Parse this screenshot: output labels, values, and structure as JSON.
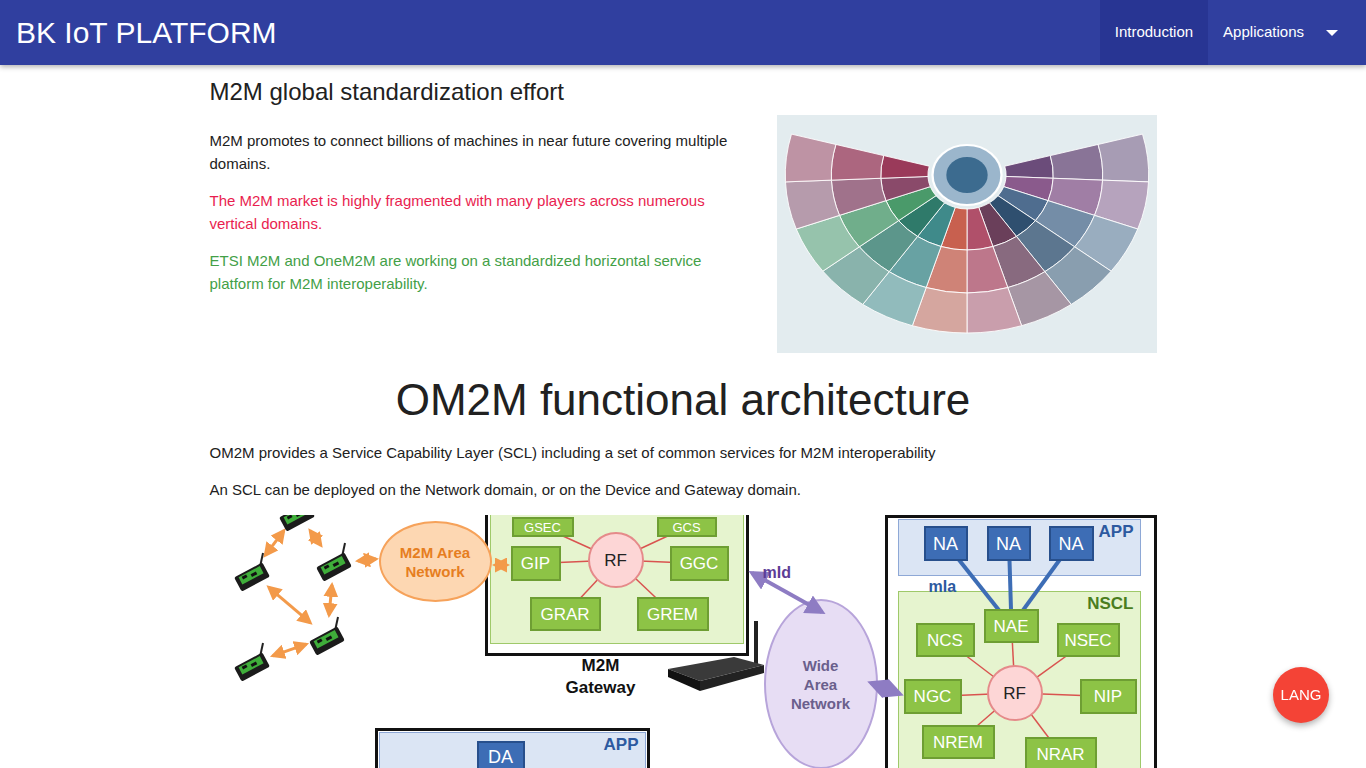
{
  "navbar": {
    "brand": "BK IoT PLATFORM",
    "items": [
      {
        "label": "Introduction",
        "selected": true,
        "dropdown": false
      },
      {
        "label": "Applications",
        "selected": false,
        "dropdown": true
      }
    ]
  },
  "intro": {
    "title": "M2M global standardization effort",
    "paragraphs": [
      {
        "text": "M2M promotes to connect billions of machines in near future covering multiple domains.",
        "color": "#212121"
      },
      {
        "text": "The M2M market is highly fragmented with many players across numerous vertical domains.",
        "color": "#e91e4f"
      },
      {
        "text": "ETSI M2M and OneM2M are working on a standardized horizontal service platform for M2M interoperability.",
        "color": "#43a047"
      }
    ]
  },
  "architecture": {
    "title": "OM2M functional architecture",
    "paragraphs": [
      "OM2M provides a Service Capability Layer (SCL) including a set of common services for M2M interoperability",
      "An SCL can be deployed on the Network domain, or on the Device and Gateway domain."
    ]
  },
  "diagram": {
    "nodes": [
      {
        "label": "GSEC",
        "kind": "gateway"
      },
      {
        "label": "GCS",
        "kind": "gateway"
      },
      {
        "label": "GIP",
        "kind": "gateway"
      },
      {
        "label": "RF",
        "kind": "rf"
      },
      {
        "label": "GGC",
        "kind": "gateway"
      },
      {
        "label": "GRAR",
        "kind": "gateway"
      },
      {
        "label": "GREM",
        "kind": "gateway"
      },
      {
        "label": "NA",
        "kind": "app"
      },
      {
        "label": "NA",
        "kind": "app"
      },
      {
        "label": "NA",
        "kind": "app"
      },
      {
        "label": "NCS",
        "kind": "gateway"
      },
      {
        "label": "NAE",
        "kind": "gateway"
      },
      {
        "label": "NSEC",
        "kind": "gateway"
      },
      {
        "label": "RF",
        "kind": "rf"
      },
      {
        "label": "NGC",
        "kind": "gateway"
      },
      {
        "label": "NIP",
        "kind": "gateway"
      },
      {
        "label": "NREM",
        "kind": "gateway"
      },
      {
        "label": "NRAR",
        "kind": "gateway"
      },
      {
        "label": "DA",
        "kind": "app"
      }
    ],
    "regions": [
      {
        "label": "APP",
        "kind": "app"
      },
      {
        "label": "NSCL",
        "kind": "scl"
      },
      {
        "label": "APP",
        "kind": "app"
      }
    ],
    "clouds": [
      {
        "label": "M2M Area Network",
        "kind": "area"
      },
      {
        "label": "Wide Area Network",
        "kind": "wide"
      }
    ],
    "captions": [
      {
        "label": "M2M Gateway",
        "kind": "caption"
      },
      {
        "label": "mId",
        "kind": "wanlink"
      },
      {
        "label": "mIa",
        "kind": "applink"
      }
    ]
  },
  "lang_button": "LANG"
}
